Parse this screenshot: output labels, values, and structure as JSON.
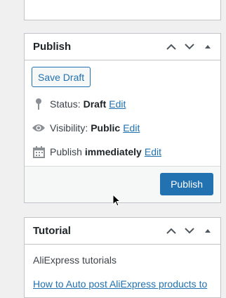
{
  "publish_box": {
    "title": "Publish",
    "save_draft_label": "Save Draft",
    "status": {
      "label": "Status:",
      "value": "Draft",
      "edit": "Edit"
    },
    "visibility": {
      "label": "Visibility:",
      "value": "Public",
      "edit": "Edit"
    },
    "publish_time": {
      "label": "Publish",
      "value": "immediately",
      "edit": "Edit"
    },
    "publish_button_label": "Publish"
  },
  "tutorial_box": {
    "title": "Tutorial",
    "text": "AliExpress tutorials",
    "link": "How to Auto post AliExpress products to"
  },
  "colors": {
    "accent": "#2271b1",
    "panel_border": "#c3c4c7",
    "background": "#f0f0f1"
  },
  "icons": {
    "collapse_up": "chevron-up-icon",
    "collapse_down": "chevron-down-icon",
    "toggle": "triangle-up-icon",
    "status": "pin-icon",
    "visibility": "eye-icon",
    "schedule": "calendar-icon"
  }
}
